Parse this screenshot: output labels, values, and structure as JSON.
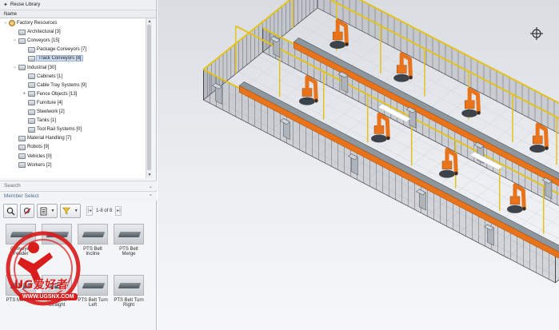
{
  "panel": {
    "title": "Reuse Library",
    "column_header": "Name"
  },
  "tree": [
    {
      "label": "Factory Resources",
      "expander": "−"
    },
    {
      "label": "Architectural [3]",
      "expander": ""
    },
    {
      "label": "Conveyors [15]",
      "expander": "−"
    },
    {
      "label": "Package Conveyors [7]",
      "expander": ""
    },
    {
      "label": "Track Conveyors [8]",
      "expander": "",
      "selected": true
    },
    {
      "label": "Industrial [30]",
      "expander": "−"
    },
    {
      "label": "Cabinets [1]",
      "expander": ""
    },
    {
      "label": "Cable Tray Systems [9]",
      "expander": ""
    },
    {
      "label": "Fence Objects [13]",
      "expander": "+"
    },
    {
      "label": "Furniture [4]",
      "expander": ""
    },
    {
      "label": "Steelwork [2]",
      "expander": ""
    },
    {
      "label": "Tanks [1]",
      "expander": ""
    },
    {
      "label": "Tool Rail Systems [0]",
      "expander": ""
    },
    {
      "label": "Material Handling [7]",
      "expander": ""
    },
    {
      "label": "Robots [9]",
      "expander": ""
    },
    {
      "label": "Vehicles [0]",
      "expander": ""
    },
    {
      "label": "Workers [2]",
      "expander": ""
    }
  ],
  "search": {
    "label": "Search",
    "chevron": "⌄"
  },
  "member_select": {
    "label": "Member Select",
    "chevron": "⌃"
  },
  "toolbar": {
    "pager_text": "1-8 of 8",
    "first_glyph": "|◂",
    "last_glyph": "▸|"
  },
  "members": [
    {
      "label": "Conveyer Feeder"
    },
    {
      "label": ""
    },
    {
      "label": "PTS Belt Incline"
    },
    {
      "label": "PTS Belt Merge"
    },
    {
      "label": "PTS Metering"
    },
    {
      "label": "PTS Belt Straight"
    },
    {
      "label": "PTS Belt Turn Left"
    },
    {
      "label": "PTS Belt Turn Right"
    }
  ],
  "watermark": {
    "text": "UG爱好者",
    "url": "WWW.UGSNX.COM"
  },
  "colors": {
    "robot": "#e8731a",
    "rail": "#e3c21c",
    "fence": "#3a3f45",
    "floor_grid": "#cfd3d8",
    "selection": "#cfdcef",
    "accent": "#4a6e9c",
    "watermark_red": "#d91c1c"
  },
  "icons": {
    "panel_pin": "pin-icon",
    "search_tool": "magnifier-icon",
    "filter_tool": "funnel-icon",
    "view_target": "crosshair-icon"
  }
}
